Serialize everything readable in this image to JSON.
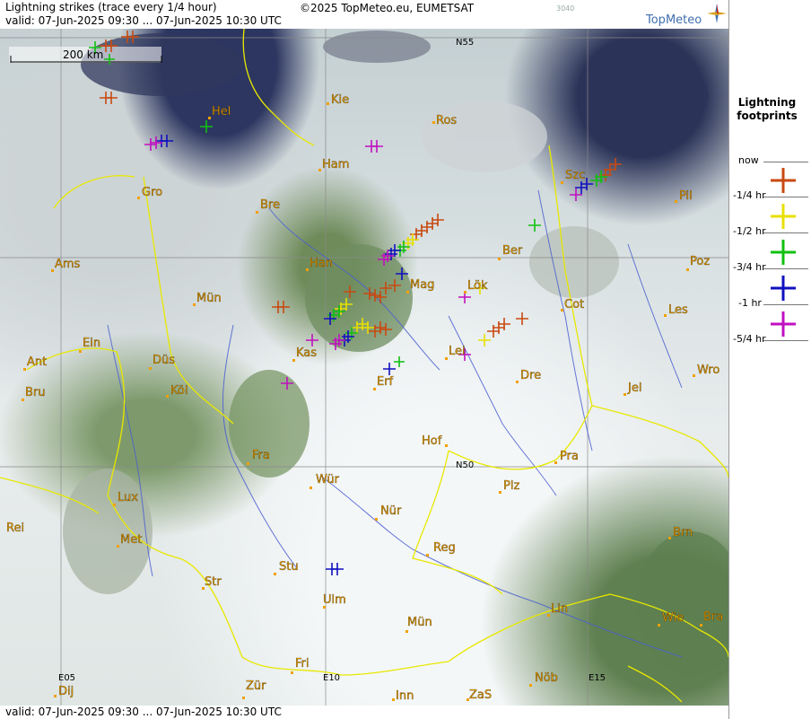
{
  "header": {
    "title": "Lightning strikes (trace every 1/4 hour)",
    "valid": "valid:  07-Jun-2025 09:30 ... 07-Jun-2025 10:30 UTC",
    "copyright": "©2025 TopMeteo.eu, EUMETSAT",
    "code": "3040",
    "logo": "TopMeteo"
  },
  "footer": {
    "valid": "valid:  07-Jun-2025 09:30 ... 07-Jun-2025 10:30 UTC"
  },
  "scale": {
    "label": "200 km"
  },
  "grid_labels": [
    "N55",
    "N50",
    "E05",
    "E10",
    "E15"
  ],
  "cities": [
    "Hel",
    "Kie",
    "Ros",
    "Ham",
    "Szc",
    "Gro",
    "Bre",
    "Pil",
    "Ber",
    "Ams",
    "Han",
    "Poz",
    "Mün",
    "Mag",
    "Lök",
    "Cot",
    "Les",
    "Ein",
    "Kas",
    "Lei",
    "Ant",
    "Düs",
    "Wro",
    "Bru",
    "Köl",
    "Erf",
    "Dre",
    "Jel",
    "Hof",
    "Fra",
    "Pra",
    "N50",
    "Würr",
    "Plz",
    "Lux",
    "Nür",
    "Rei",
    "Met",
    "Reg",
    "Brn",
    "Stu",
    "Str",
    "Ulm",
    "Lin",
    "Wie",
    "Bra",
    "Mün2",
    "Fri",
    "Zür",
    "Nöb",
    "Dij",
    "Inn",
    "ZaS"
  ],
  "city_names": {
    "Hel": "Hel",
    "Kie": "Kie",
    "Ros": "Ros",
    "Ham": "Ham",
    "Szc": "Szc",
    "Gro": "Gro",
    "Bre": "Bre",
    "Pil": "Pil",
    "Ber": "Ber",
    "Ams": "Ams",
    "Han": "Han",
    "Poz": "Poz",
    "Mün": "Mün",
    "Mag": "Mag",
    "Lök": "Lök",
    "Cot": "Cot",
    "Les": "Les",
    "Ein": "Ein",
    "Kas": "Kas",
    "Lei": "Lei",
    "Ant": "Ant",
    "Düs": "Düs",
    "Wro": "Wro",
    "Bru": "Bru",
    "Köl": "Köl",
    "Erf": "Erf",
    "Dre": "Dre",
    "Jel": "Jel",
    "Hof": "Hof",
    "Fra": "Fra",
    "Pra": "Pra",
    "Würr": "Wür",
    "Plz": "Plz",
    "Lux": "Lux",
    "Nür": "Nür",
    "Rei": "Rei",
    "Met": "Met",
    "Reg": "Reg",
    "Brn": "Brn",
    "Stu": "Stu",
    "Str": "Str",
    "Ulm": "Ulm",
    "Lin": "Lin",
    "Wie": "Wie",
    "Bra": "Bra",
    "Mün2": "Mün",
    "Fri": "Fri",
    "Zür": "Zür",
    "Nöb": "Nöb",
    "Dij": "Dij",
    "Inn": "Inn",
    "ZaS": "ZaS"
  },
  "legend": {
    "title_line1": "Lightning",
    "title_line2": "footprints",
    "items": [
      {
        "label": "now",
        "color": ""
      },
      {
        "label": "-1/4 hr",
        "color": "#c84a10"
      },
      {
        "label": "-1/2 hr",
        "color": "#e8e000"
      },
      {
        "label": "-3/4 hr",
        "color": "#10c010"
      },
      {
        "label": "-1 hr",
        "color": "#1010c0"
      },
      {
        "label": "-5/4 hr",
        "color": "#c010c0"
      }
    ]
  },
  "colors": {
    "recent": "#c84a10",
    "half": "#e8e000",
    "three_quarter": "#10c010",
    "hour": "#1010c0",
    "oldest": "#c010c0",
    "city_label": "#f0a000",
    "border": "#e8e800",
    "river": "#4a5fd0"
  }
}
